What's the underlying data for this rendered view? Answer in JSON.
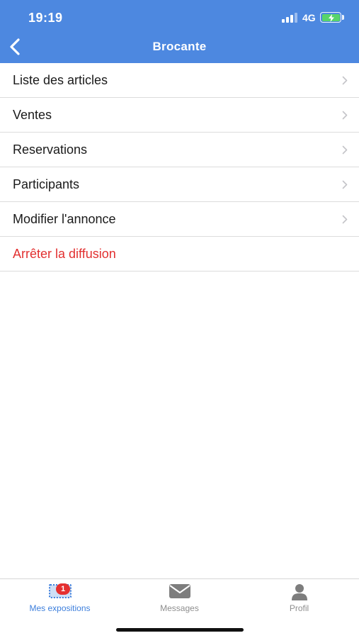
{
  "status_bar": {
    "time": "19:19",
    "network": "4G",
    "battery_charging": true
  },
  "nav": {
    "title": "Brocante",
    "back_icon": "chevron-left-icon"
  },
  "menu": {
    "items": [
      {
        "label": "Liste des articles"
      },
      {
        "label": "Ventes"
      },
      {
        "label": "Reservations"
      },
      {
        "label": "Participants"
      },
      {
        "label": "Modifier l'annonce"
      }
    ],
    "danger_item": {
      "label": "Arrêter la diffusion",
      "color": "#e23030"
    }
  },
  "tabbar": {
    "tabs": [
      {
        "label": "Mes expositions",
        "icon": "exhibition-icon",
        "active": true,
        "badge": "1"
      },
      {
        "label": "Messages",
        "icon": "envelope-icon",
        "active": false
      },
      {
        "label": "Profil",
        "icon": "user-icon",
        "active": false
      }
    ]
  },
  "colors": {
    "header": "#4d88e0",
    "accent": "#3d7fdc",
    "danger": "#e23030",
    "badge": "#e53030"
  }
}
